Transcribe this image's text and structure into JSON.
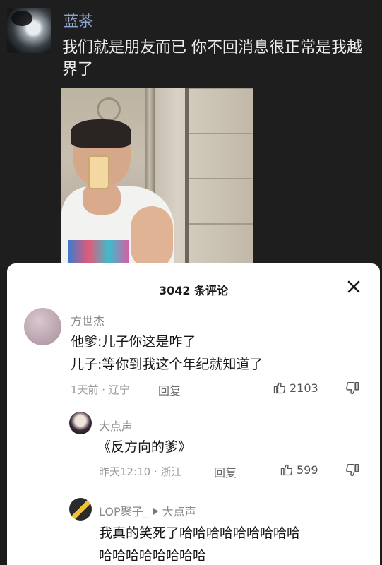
{
  "post": {
    "author": "蓝茶",
    "text": "我们就是朋友而已 你不回消息很正常是我越界了"
  },
  "comments_sheet": {
    "title": "3042 条评论",
    "comments": [
      {
        "author": "方世杰",
        "lines": [
          "他爹:儿子你这是咋了",
          "儿子:等你到我这个年纪就知道了"
        ],
        "meta": "1天前 · 辽宁",
        "reply_label": "回复",
        "likes": "2103"
      },
      {
        "author": "大点声",
        "lines": [
          "《反方向的爹》"
        ],
        "meta": "昨天12:10 · 浙江",
        "reply_label": "回复",
        "likes": "599"
      },
      {
        "author": "LOP聚子_",
        "reply_to": "大点声",
        "lines": [
          "我真的笑死了哈哈哈哈哈哈哈哈哈",
          "哈哈哈哈哈哈哈哈"
        ]
      }
    ]
  },
  "colors": {
    "background": "#1c1c1c",
    "author_name": "#8fa7d0",
    "sheet": "#ffffff"
  },
  "icons": [
    "close-icon",
    "thumbs-up-icon",
    "thumbs-down-icon"
  ]
}
